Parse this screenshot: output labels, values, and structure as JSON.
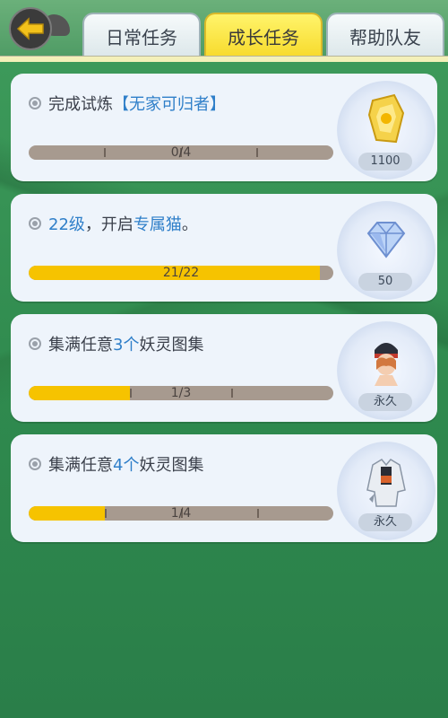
{
  "tabs": [
    {
      "label": "日常任务",
      "active": false
    },
    {
      "label": "成长任务",
      "active": true
    },
    {
      "label": "帮助队友",
      "active": false
    }
  ],
  "quests": [
    {
      "title_parts": [
        "完成试炼",
        "【无家可归者】"
      ],
      "progress_text": "0/4",
      "progress": 0.0,
      "reward_icon": "gold-crest-icon",
      "reward_count": "1100"
    },
    {
      "title_parts": [
        "22级",
        "，开启",
        "专属猫",
        "。"
      ],
      "progress_text": "21/22",
      "progress": 0.955,
      "reward_icon": "diamond-icon",
      "reward_count": "50"
    },
    {
      "title_parts": [
        "集满任意",
        "3个",
        "妖灵图集"
      ],
      "progress_text": "1/3",
      "progress": 0.333,
      "reward_icon": "avatar-head-icon",
      "reward_count": "永久"
    },
    {
      "title_parts": [
        "集满任意",
        "4个",
        "妖灵图集"
      ],
      "progress_text": "1/4",
      "progress": 0.25,
      "reward_icon": "avatar-outfit-icon",
      "reward_count": "永久"
    }
  ],
  "colors": {
    "accent": "#2f7fc9",
    "progress_fill": "#f6c300",
    "progress_track": "#a79a8f",
    "active_tab": "#f7da2b"
  }
}
